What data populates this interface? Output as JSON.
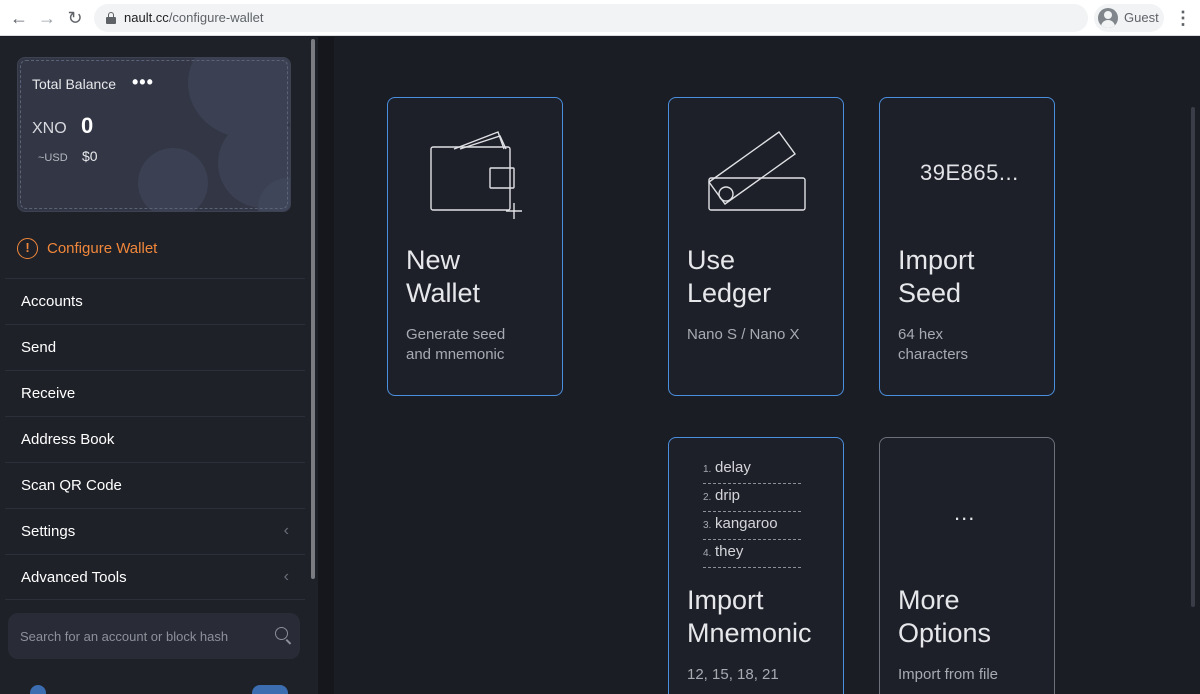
{
  "browser": {
    "url_domain": "nault.cc",
    "url_path": "/configure-wallet",
    "profile_label": "Guest"
  },
  "sidebar": {
    "balance": {
      "title": "Total Balance",
      "menu_glyph": "•••",
      "currency": "XNO",
      "amount": "0",
      "fiat_label": "~USD",
      "fiat_amount": "$0"
    },
    "configure_label": "Configure Wallet",
    "items": [
      {
        "label": "Accounts"
      },
      {
        "label": "Send"
      },
      {
        "label": "Receive"
      },
      {
        "label": "Address Book"
      },
      {
        "label": "Scan QR Code"
      },
      {
        "label": "Settings"
      },
      {
        "label": "Advanced Tools"
      }
    ],
    "search_placeholder": "Search for an account or block hash"
  },
  "options": [
    {
      "title_1": "New",
      "title_2": "Wallet",
      "desc_1": "Generate seed",
      "desc_2": "and mnemonic",
      "icon": "wallet-add-icon"
    },
    {
      "title_1": "Use",
      "title_2": "Ledger",
      "desc_1": "Nano S / Nano X",
      "desc_2": "",
      "icon": "ledger-device-icon"
    },
    {
      "title_1": "Import",
      "title_2": "Seed",
      "desc_1": "64 hex",
      "desc_2": "characters",
      "seed_preview": "39E865..."
    },
    {
      "title_1": "Import",
      "title_2": "Mnemonic",
      "desc_1": "12, 15, 18, 21",
      "words": [
        {
          "n": "1.",
          "w": "delay"
        },
        {
          "n": "2.",
          "w": "drip"
        },
        {
          "n": "3.",
          "w": "kangaroo"
        },
        {
          "n": "4.",
          "w": "they"
        }
      ]
    },
    {
      "title_1": "More",
      "title_2": "Options",
      "desc_1": "Import from file",
      "glyph": "..."
    }
  ],
  "colors": {
    "accent": "#4a8fdd",
    "warning": "#f0873a",
    "background": "#1b1d25"
  }
}
